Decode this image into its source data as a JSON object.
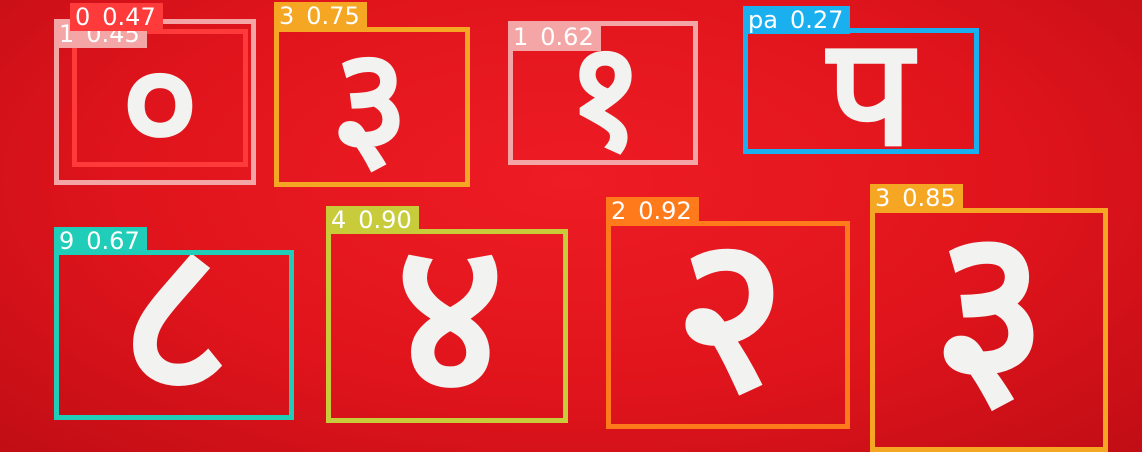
{
  "glyphs": [
    "०",
    "३",
    "१",
    "प",
    "८",
    "४",
    "२",
    "३"
  ],
  "detections": [
    {
      "label": "1",
      "score": "0.45",
      "color": "#f4a6a6"
    },
    {
      "label": "0",
      "score": "0.47",
      "color": "#ff3a3a"
    },
    {
      "label": "3",
      "score": "0.75",
      "color": "#f5a623"
    },
    {
      "label": "1",
      "score": "0.62",
      "color": "#f4a6a6"
    },
    {
      "label": "pa",
      "score": "0.27",
      "color": "#1ab0f0"
    },
    {
      "label": "9",
      "score": "0.67",
      "color": "#1fcdb8"
    },
    {
      "label": "4",
      "score": "0.90",
      "color": "#c8cc3a"
    },
    {
      "label": "2",
      "score": "0.92",
      "color": "#ff7a1a"
    },
    {
      "label": "3",
      "score": "0.85",
      "color": "#f5a623"
    }
  ]
}
